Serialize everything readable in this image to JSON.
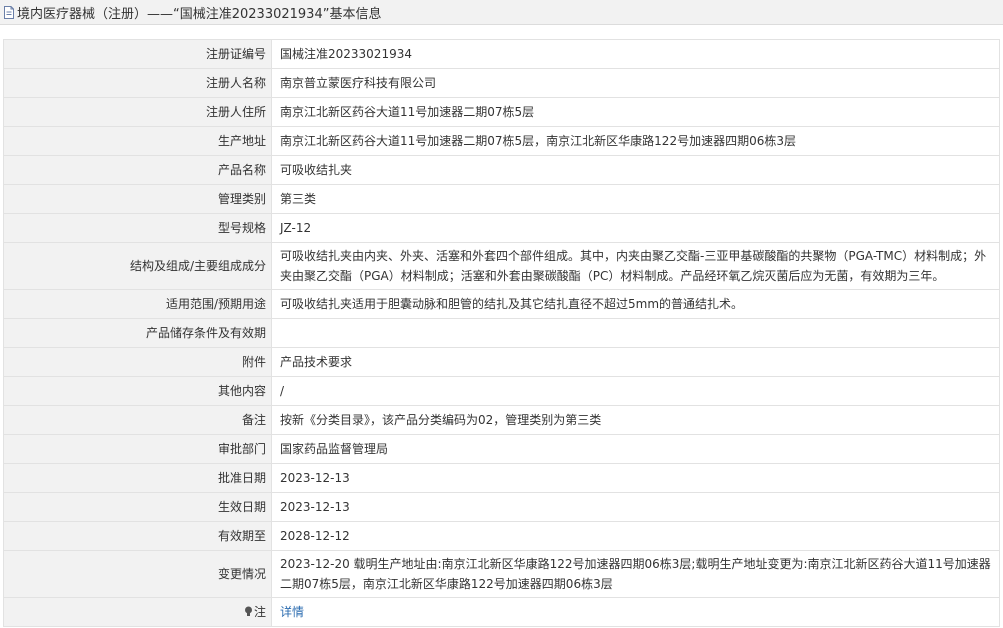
{
  "header": {
    "title": "境内医疗器械（注册）——“国械注准20233021934”基本信息"
  },
  "rows": [
    {
      "label": "注册证编号",
      "value": "国械注准20233021934"
    },
    {
      "label": "注册人名称",
      "value": "南京普立蒙医疗科技有限公司"
    },
    {
      "label": "注册人住所",
      "value": "南京江北新区药谷大道11号加速器二期07栋5层"
    },
    {
      "label": "生产地址",
      "value": "南京江北新区药谷大道11号加速器二期07栋5层，南京江北新区华康路122号加速器四期06栋3层"
    },
    {
      "label": "产品名称",
      "value": "可吸收结扎夹"
    },
    {
      "label": "管理类别",
      "value": "第三类"
    },
    {
      "label": "型号规格",
      "value": "JZ-12"
    },
    {
      "label": "结构及组成/主要组成成分",
      "value": "可吸收结扎夹由内夹、外夹、活塞和外套四个部件组成。其中，内夹由聚乙交酯-三亚甲基碳酸酯的共聚物（PGA-TMC）材料制成；外夹由聚乙交酯（PGA）材料制成；活塞和外套由聚碳酸酯（PC）材料制成。产品经环氧乙烷灭菌后应为无菌，有效期为三年。"
    },
    {
      "label": "适用范围/预期用途",
      "value": "可吸收结扎夹适用于胆囊动脉和胆管的结扎及其它结扎直径不超过5mm的普通结扎术。"
    },
    {
      "label": "产品储存条件及有效期",
      "value": ""
    },
    {
      "label": "附件",
      "value": "产品技术要求"
    },
    {
      "label": "其他内容",
      "value": "/"
    },
    {
      "label": "备注",
      "value": "按新《分类目录》，该产品分类编码为02，管理类别为第三类"
    },
    {
      "label": "审批部门",
      "value": "国家药品监督管理局"
    },
    {
      "label": "批准日期",
      "value": "2023-12-13"
    },
    {
      "label": "生效日期",
      "value": "2023-12-13"
    },
    {
      "label": "有效期至",
      "value": "2028-12-12"
    },
    {
      "label": "变更情况",
      "value": "2023-12-20 载明生产地址由:南京江北新区华康路122号加速器四期06栋3层;载明生产地址变更为:南京江北新区药谷大道11号加速器二期07栋5层，南京江北新区华康路122号加速器四期06栋3层"
    }
  ],
  "note": {
    "label": "注",
    "link_text": "详情",
    "icon": "lightbulb-icon"
  }
}
